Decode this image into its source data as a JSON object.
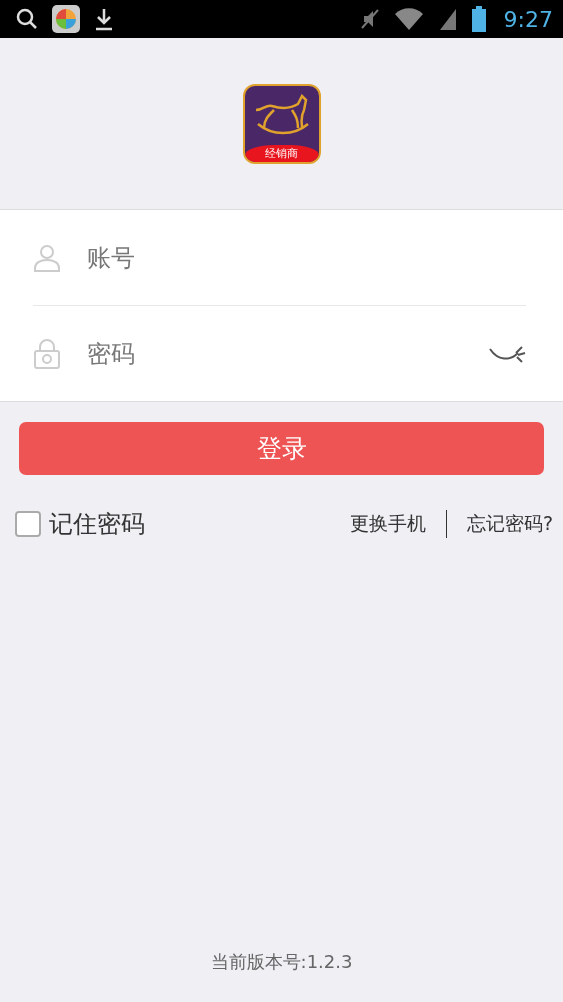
{
  "status_bar": {
    "time": "9:27"
  },
  "logo": {
    "caption": "经销商"
  },
  "form": {
    "account": {
      "placeholder": "账号"
    },
    "password": {
      "placeholder": "密码",
      "visible": false
    }
  },
  "login_button": "登录",
  "remember": {
    "label": "记住密码",
    "checked": false
  },
  "links": [
    "更换手机",
    "忘记密码?"
  ],
  "version": "当前版本号:1.2.3"
}
